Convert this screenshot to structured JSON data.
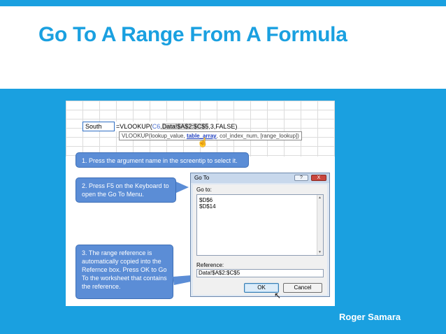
{
  "slide": {
    "title": "Go To A Range From A Formula",
    "author": "Roger Samara"
  },
  "colors": {
    "accent": "#1aa0e0",
    "callout": "#5b8dd6",
    "dialog_bg": "#dfe8f3"
  },
  "spreadsheet": {
    "cell_value": "South",
    "formula": {
      "prefix": "=VLOOKUP(",
      "ref_c6": "C6",
      "sep1": ",",
      "range": "Data!$A$2:$C$5",
      "suffix": ",3,FALSE)"
    },
    "screentip": {
      "prefix": "VLOOKUP(lookup_value, ",
      "active_arg": "table_array",
      "suffix": ", col_index_num, [range_lookup])"
    },
    "hand_cursor_icon": "hand-pointer-icon"
  },
  "callouts": {
    "step1": "1. Press the argument name in the screentip to select it.",
    "step2": "2. Press F5 on the Keyboard to open the Go To Menu.",
    "step3": "3. The range reference is automatically copied into the Refernce box.  Press OK to Go To the worksheet that contains the reference."
  },
  "dialog": {
    "title": "Go To",
    "help_label": "?",
    "close_label": "X",
    "goto_label": "Go to:",
    "goto_items": [
      "$D$6",
      "$D$14"
    ],
    "reference_label": "Reference:",
    "reference_value": "Data!$A$2:$C$5",
    "ok_label": "OK",
    "cancel_label": "Cancel",
    "scroll_up": "▲",
    "scroll_down": "▼"
  }
}
